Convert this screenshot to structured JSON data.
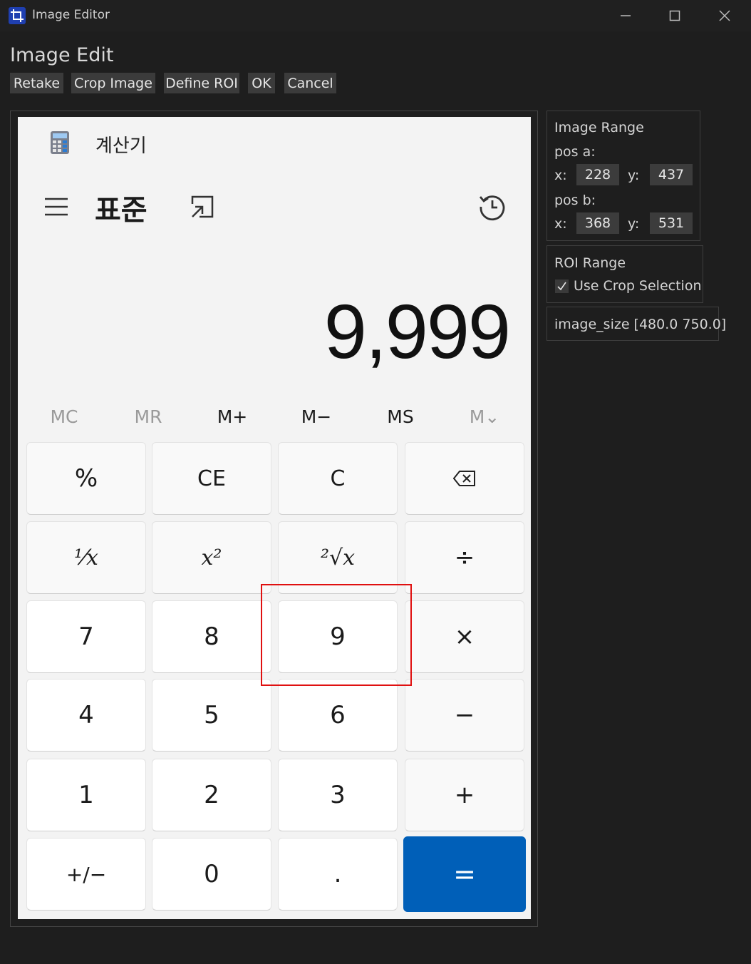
{
  "window": {
    "title": "Image Editor"
  },
  "editor": {
    "heading": "Image Edit",
    "toolbar": [
      "Retake",
      "Crop Image",
      "Define ROI",
      "OK",
      "Cancel"
    ]
  },
  "calculator": {
    "title": "계산기",
    "mode": "표준",
    "display": "9,999",
    "memory": [
      {
        "label": "MC",
        "enabled": false
      },
      {
        "label": "MR",
        "enabled": false
      },
      {
        "label": "M+",
        "enabled": true
      },
      {
        "label": "M−",
        "enabled": true
      },
      {
        "label": "MS",
        "enabled": true
      },
      {
        "label": "M⌄",
        "enabled": false
      }
    ],
    "keys": [
      [
        "%",
        "CE",
        "C",
        "backspace-icon"
      ],
      [
        "¹⁄x",
        "x²",
        "²√x",
        "÷"
      ],
      [
        "7",
        "8",
        "9",
        "×"
      ],
      [
        "4",
        "5",
        "6",
        "−"
      ],
      [
        "1",
        "2",
        "3",
        "+"
      ],
      [
        "+/−",
        "0",
        ".",
        "="
      ]
    ],
    "accent_color": "#005fb8",
    "roi_color": "#e01010"
  },
  "image_range": {
    "title": "Image Range",
    "pos_a_label": "pos a:",
    "pos_b_label": "pos b:",
    "x_label": "x:",
    "y_label": "y:",
    "pos_a": {
      "x": "228",
      "y": "437"
    },
    "pos_b": {
      "x": "368",
      "y": "531"
    }
  },
  "roi_range": {
    "title": "ROI Range",
    "use_crop_label": "Use Crop Selection",
    "use_crop_checked": true
  },
  "image_size_text": "image_size [480.0 750.0]"
}
